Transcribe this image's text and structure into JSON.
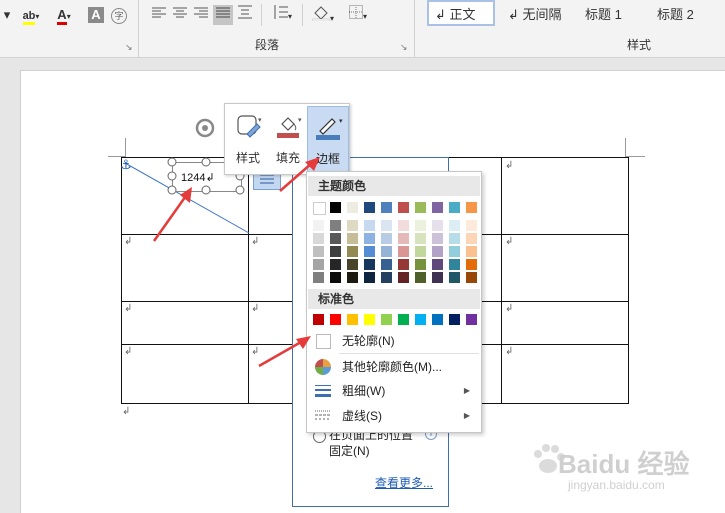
{
  "ribbon": {
    "paragraph_group_label": "段落",
    "styles_group_label": "样式",
    "styles": [
      "↲ 正文",
      "↲ 无间隔",
      "标题 1",
      "标题 2"
    ],
    "font_icons": [
      "highlight-icon",
      "font-color-icon",
      "char-shading-icon",
      "enclose-char-icon"
    ],
    "char_shading_label": "A",
    "enclose_char_label": "字",
    "font_color_label": "A",
    "highlight_label": "ab"
  },
  "mini_toolbar": {
    "style_label": "样式",
    "fill_label": "填充",
    "border_label": "边框"
  },
  "textbox": {
    "value": "1244↲"
  },
  "dropdown": {
    "theme_colors_label": "主题颜色",
    "standard_colors_label": "标准色",
    "no_outline_label": "无轮廓(N)",
    "more_colors_label": "其他轮廓颜色(M)...",
    "weight_label": "粗细(W)",
    "dashes_label": "虚线(S)",
    "theme_top_row": [
      "#ffffff",
      "#000000",
      "#eeece1",
      "#1f497d",
      "#4f81bd",
      "#c0504d",
      "#9bbb59",
      "#8064a2",
      "#4bacc6",
      "#f79646"
    ],
    "theme_shades": [
      [
        "#f2f2f2",
        "#7f7f7f",
        "#ddd9c3",
        "#c6d9f0",
        "#dbe5f1",
        "#f2dcdb",
        "#ebf1dd",
        "#e5e0ec",
        "#dbeef3",
        "#fdeada"
      ],
      [
        "#d8d8d8",
        "#595959",
        "#c4bd97",
        "#8db3e2",
        "#b8cce4",
        "#e5b9b7",
        "#d7e3bc",
        "#ccc1d9",
        "#b7dde8",
        "#fbd5b5"
      ],
      [
        "#bfbfbf",
        "#3f3f3f",
        "#938953",
        "#548dd4",
        "#95b3d7",
        "#d99694",
        "#c3d69b",
        "#b2a2c7",
        "#92cddc",
        "#fac08f"
      ],
      [
        "#a5a5a5",
        "#262626",
        "#494429",
        "#17365d",
        "#366092",
        "#953734",
        "#76923c",
        "#5f497a",
        "#31859b",
        "#e36c09"
      ],
      [
        "#7f7f7f",
        "#0c0c0c",
        "#1d1b10",
        "#0f243e",
        "#244061",
        "#632423",
        "#4f6128",
        "#3f3151",
        "#205867",
        "#974806"
      ]
    ],
    "standard_colors": [
      "#c00000",
      "#ff0000",
      "#ffc000",
      "#ffff00",
      "#92d050",
      "#00b050",
      "#00b0f0",
      "#0070c0",
      "#002060",
      "#7030a0"
    ]
  },
  "side_panel": {
    "option_text_line1": "在页面上的位置",
    "option_text_line2": "固定(N)",
    "see_more": "查看更多..."
  },
  "watermark": {
    "brand": "Baidu 经验",
    "url": "jingyan.baidu.com"
  }
}
